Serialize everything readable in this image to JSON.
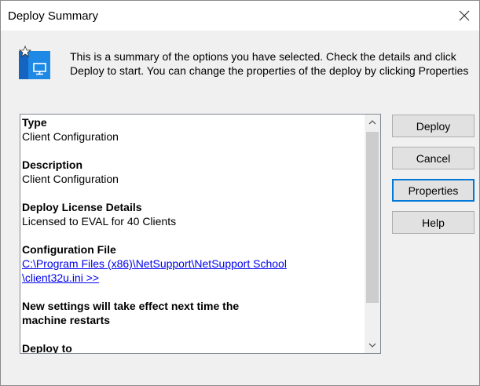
{
  "window": {
    "title": "Deploy Summary",
    "close_icon": "close-icon"
  },
  "intro": {
    "icon": "deploy-client-icon",
    "text": "This is a summary of the options you have selected. Check the details and click Deploy to start. You can change the properties of the deploy by clicking Properties"
  },
  "summary": {
    "type_heading": "Type",
    "type_value": "Client Configuration",
    "description_heading": "Description",
    "description_value": "Client Configuration",
    "license_heading": "Deploy License Details",
    "license_value": "Licensed to EVAL for 40 Clients",
    "config_heading": "Configuration File",
    "config_link_line1": "C:\\Program Files (x86)\\NetSupport\\NetSupport School",
    "config_link_line2": "\\client32u.ini >>",
    "restart_note_line1": "New settings will take effect next time the",
    "restart_note_line2": "machine restarts",
    "partial_heading": "Deploy to"
  },
  "buttons": {
    "deploy": "Deploy",
    "cancel": "Cancel",
    "properties": "Properties",
    "help": "Help"
  },
  "colors": {
    "accent": "#0078d7",
    "link": "#0000ee",
    "icon_blue": "#1e88e5"
  }
}
